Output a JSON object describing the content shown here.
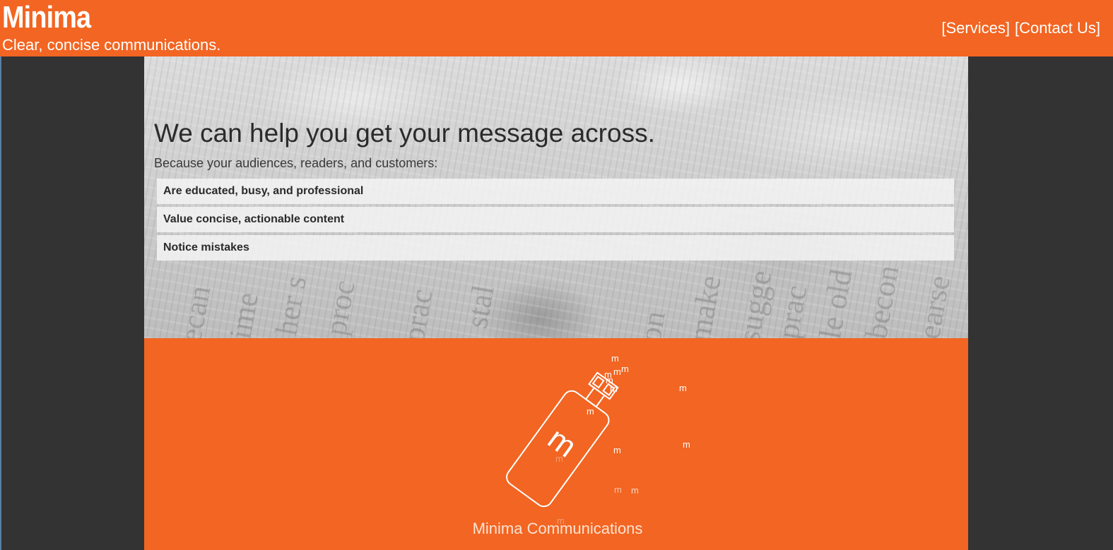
{
  "header": {
    "brand": "Minima",
    "tagline": "Clear, concise communications.",
    "nav": [
      {
        "label": "[Services]"
      },
      {
        "label": "[Contact Us]"
      }
    ]
  },
  "hero": {
    "title": "We can help you get your message across.",
    "subtitle": "Because your audiences, readers, and customers:",
    "reasons": [
      "Are educated, busy, and professional",
      "Value concise, actionable content",
      "Notice mistakes"
    ]
  },
  "footer": {
    "company_name": "Minima Communications",
    "logo_glyph": "m",
    "logo_icon": "spray-bottle-icon"
  },
  "colors": {
    "brand_orange": "#f26522",
    "page_background": "#333333",
    "text_dark": "#2b2b2b"
  }
}
